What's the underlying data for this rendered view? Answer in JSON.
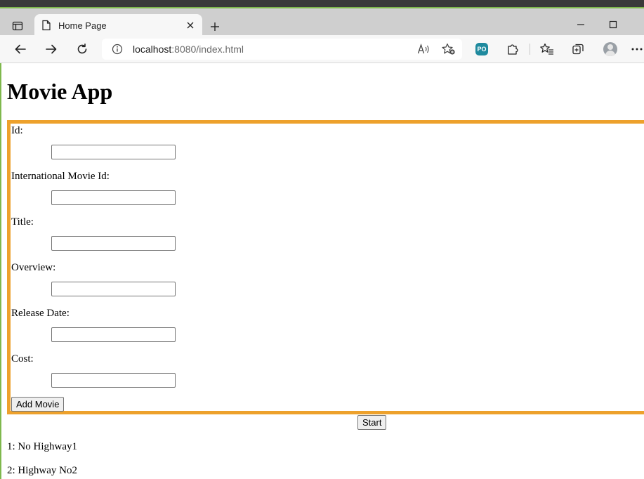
{
  "browser": {
    "tab_title": "Home Page",
    "url_host": "localhost",
    "url_rest": ":8080/index.html",
    "extension_badge": "PO"
  },
  "page": {
    "title": "Movie App",
    "form": {
      "fields": [
        {
          "label": "Id:",
          "value": ""
        },
        {
          "label": "International Movie Id:",
          "value": ""
        },
        {
          "label": "Title:",
          "value": ""
        },
        {
          "label": "Overview:",
          "value": ""
        },
        {
          "label": "Release Date:",
          "value": ""
        },
        {
          "label": "Cost:",
          "value": ""
        }
      ],
      "submit_label": "Add Movie"
    },
    "start_label": "Start",
    "results": [
      "1: No Highway1",
      "2: Highway No2"
    ]
  },
  "colors": {
    "form_border": "#eda12c",
    "window_accent": "#7fb84d"
  }
}
